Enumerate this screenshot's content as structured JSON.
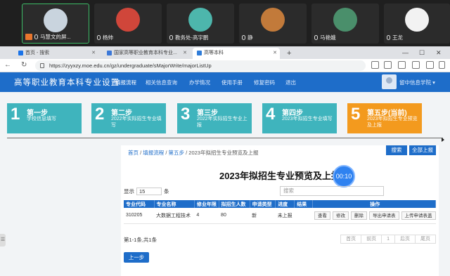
{
  "meeting": {
    "participants": [
      {
        "name": "马慧文的屏...",
        "sharing": true,
        "color": "#c9d4de"
      },
      {
        "name": "杨帅",
        "sharing": false,
        "color": "#d0463a"
      },
      {
        "name": "教务处-高宇鹏",
        "sharing": false,
        "color": "#4db6ac"
      },
      {
        "name": "静",
        "sharing": false,
        "color": "#c27a3a"
      },
      {
        "name": "马艳娥",
        "sharing": false,
        "color": "#4a8f6b"
      },
      {
        "name": "王龙",
        "sharing": false,
        "color": "#f2f2f2"
      }
    ]
  },
  "browser": {
    "tabs": [
      {
        "label": "首页 - 搜索",
        "color": "#1a73e8"
      },
      {
        "label": "国家高等职业教育本科专业...",
        "color": "#3c78d8"
      },
      {
        "label": "高等本科",
        "color": "#2f7cd8"
      }
    ],
    "new_tab": "+",
    "url": "https://zyyxzy.moe.edu.cn/gz/undergraduate/sMajorWrite/majorListUp",
    "win_min": "—",
    "win_max": "☐",
    "win_close": "✕"
  },
  "site": {
    "title": "高等职业教育本科专业设置",
    "nav": [
      "填报流程",
      "相关信息查询",
      "办学情况",
      "使用手册",
      "修复密码",
      "退出"
    ],
    "user": "留中信息学院 ▾"
  },
  "steps": [
    {
      "num": "1",
      "label": "第一步",
      "sub": "学校信息填写"
    },
    {
      "num": "2",
      "label": "第二步",
      "sub": "2022年实际招生专业填写"
    },
    {
      "num": "3",
      "label": "第三步",
      "sub": "2022年实际招生专业上报"
    },
    {
      "num": "4",
      "label": "第四步",
      "sub": "2023年拟招生专业填写"
    },
    {
      "num": "5",
      "label": "第五步(当前)",
      "sub": "2023年拟招生专业预览及上报",
      "current": true
    }
  ],
  "breadcrumb": {
    "home": "首页",
    "flow": "填报流程",
    "step": "第五步",
    "current": "2023年拟招生专业预览及上报"
  },
  "panel_title": "2023年拟招生专业预览及上报",
  "timer": "00:10",
  "list": {
    "show_prefix": "显示",
    "page_size": "15",
    "show_suffix": "条",
    "search_placeholder": "搜索",
    "search_button": "搜索",
    "report_all_button": "全部上报",
    "columns": [
      "专业代码",
      "专业名称",
      "修业年限",
      "拟招生人数",
      "申请类型",
      "进度",
      "结果",
      "操作"
    ],
    "rows": [
      {
        "code": "310205",
        "name": "大数据工程技术",
        "years": "4",
        "count": "80",
        "type": "新",
        "progress": "未上报",
        "result": ""
      }
    ],
    "ops": [
      "查看",
      "修改",
      "删除",
      "导出申请表",
      "上传申请表盖"
    ],
    "info": "第1-1条,共1条",
    "pager": [
      "首页",
      "前页",
      "1",
      "后页",
      "尾页"
    ],
    "prev_step": "上一步"
  },
  "side_handle": "☰"
}
